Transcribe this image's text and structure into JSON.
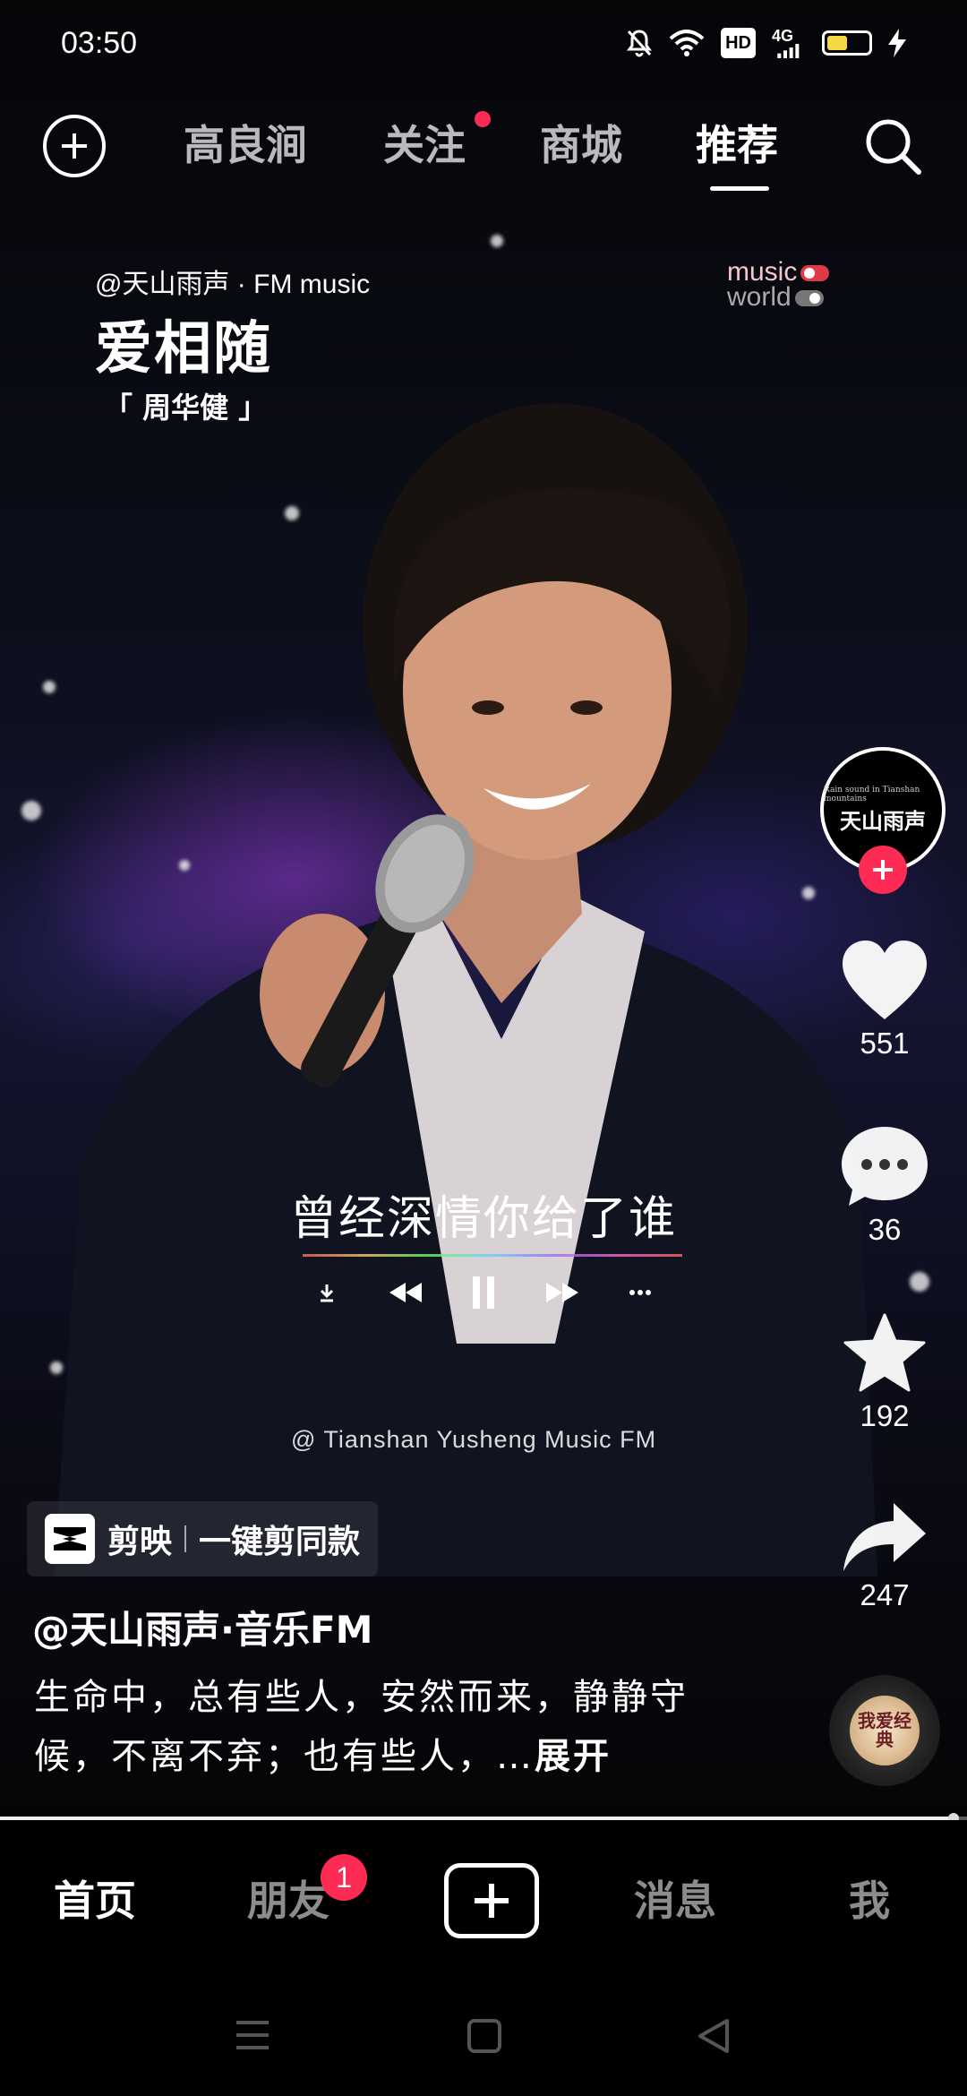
{
  "status_bar": {
    "time": "03:50",
    "hd": "HD",
    "network": "4G"
  },
  "top_nav": {
    "tabs": [
      "高良涧",
      "关注",
      "商城",
      "推荐"
    ],
    "active_tab": "推荐",
    "follow_has_dot": true
  },
  "video_overlay": {
    "author": "@天山雨声 · FM music",
    "song_title": "爱相随",
    "artist": "「 周华健 」",
    "logo_line1": "music",
    "logo_line2": "world",
    "lyric": "曾经深情你给了谁",
    "credit": "@ Tianshan Yusheng Music FM"
  },
  "right_rail": {
    "avatar_text": "天山雨声",
    "avatar_subtext": "Rain sound in Tianshan mountains",
    "likes": "551",
    "comments": "36",
    "favorites": "192",
    "shares": "247",
    "disc_text": "我爱经典"
  },
  "caption": {
    "capcut_name": "剪映",
    "capcut_action": "一键剪同款",
    "author_handle": "@天山雨声·音乐FM",
    "text": "生命中，总有些人，安然而来，静静守候，不离不弃；也有些人，…",
    "expand_label": "展开"
  },
  "playback": {
    "progress": 0.99
  },
  "bottom_tabs": {
    "home": "首页",
    "friends": "朋友",
    "friends_badge": "1",
    "messages": "消息",
    "me": "我"
  },
  "colors": {
    "accent": "#fe2c55",
    "background": "#000000"
  }
}
